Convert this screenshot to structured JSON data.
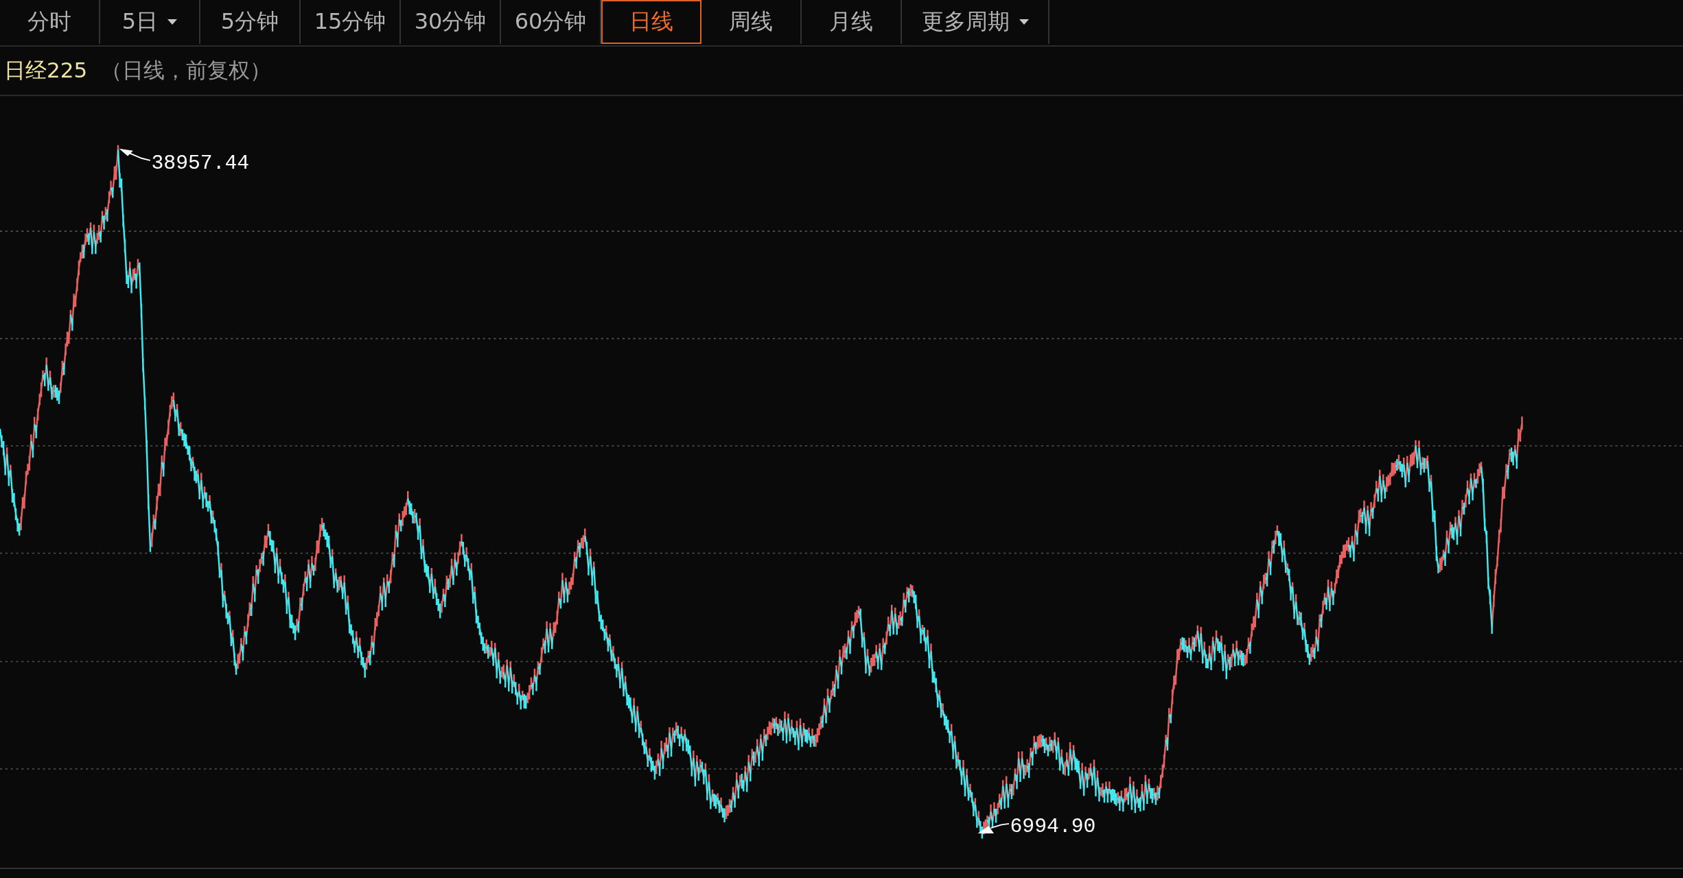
{
  "tabs": [
    {
      "label": "分时",
      "selected": false,
      "dropdown": false
    },
    {
      "label": "5日",
      "selected": false,
      "dropdown": true
    },
    {
      "label": "5分钟",
      "selected": false,
      "dropdown": false
    },
    {
      "label": "15分钟",
      "selected": false,
      "dropdown": false
    },
    {
      "label": "30分钟",
      "selected": false,
      "dropdown": false
    },
    {
      "label": "60分钟",
      "selected": false,
      "dropdown": false
    },
    {
      "label": "日线",
      "selected": true,
      "dropdown": false
    },
    {
      "label": "周线",
      "selected": false,
      "dropdown": false
    },
    {
      "label": "月线",
      "selected": false,
      "dropdown": false
    },
    {
      "label": "更多周期",
      "selected": false,
      "dropdown": true
    }
  ],
  "title": {
    "name": "日经225",
    "subtitle": "（日线，前复权）"
  },
  "chart": {
    "high_label": "38957.44",
    "low_label": "6994.90"
  }
}
